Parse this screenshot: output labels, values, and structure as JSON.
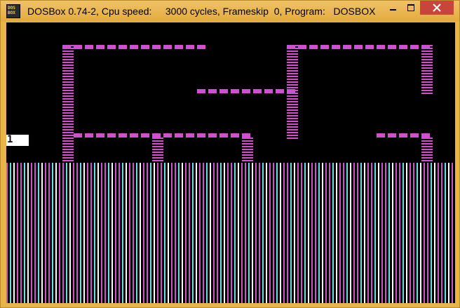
{
  "window": {
    "title": "DOSBox 0.74-2, Cpu speed:     3000 cycles, Frameskip  0, Program:   DOSBOX",
    "icon": "dosbox-icon",
    "icon_text_top": "DOS",
    "icon_text_bottom": "BOX"
  },
  "controls": {
    "minimize_icon": "minimize-icon",
    "maximize_icon": "maximize-icon",
    "close_icon": "close-icon"
  },
  "game": {
    "counter": "1",
    "colors": {
      "wall": "#d050d0",
      "stripe_cyan": "#60e0e0",
      "stripe_white": "#ffffff",
      "background": "#000000"
    }
  }
}
